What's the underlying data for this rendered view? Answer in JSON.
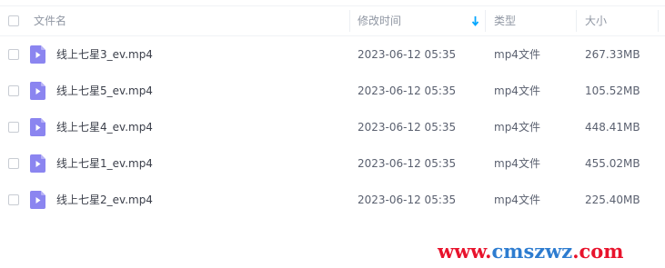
{
  "colors": {
    "sort_accent": "#06a7ff",
    "file_icon": "#8b85f0",
    "watermark_red": "#e8132c",
    "watermark_blue": "#2d7cd0"
  },
  "header": {
    "name_label": "文件名",
    "modified_label": "修改时间",
    "sort_icon": "sort-down-arrow",
    "type_label": "类型",
    "size_label": "大小"
  },
  "files": [
    {
      "name": "线上七星3_ev.mp4",
      "modified": "2023-06-12 05:35",
      "type": "mp4文件",
      "size": "267.33MB",
      "icon": "video-file-icon"
    },
    {
      "name": "线上七星5_ev.mp4",
      "modified": "2023-06-12 05:35",
      "type": "mp4文件",
      "size": "105.52MB",
      "icon": "video-file-icon"
    },
    {
      "name": "线上七星4_ev.mp4",
      "modified": "2023-06-12 05:35",
      "type": "mp4文件",
      "size": "448.41MB",
      "icon": "video-file-icon"
    },
    {
      "name": "线上七星1_ev.mp4",
      "modified": "2023-06-12 05:35",
      "type": "mp4文件",
      "size": "455.02MB",
      "icon": "video-file-icon"
    },
    {
      "name": "线上七星2_ev.mp4",
      "modified": "2023-06-12 05:35",
      "type": "mp4文件",
      "size": "225.40MB",
      "icon": "video-file-icon"
    }
  ],
  "watermark": {
    "prefix": "www.",
    "brand": "cmszwz",
    "suffix": ".com"
  }
}
